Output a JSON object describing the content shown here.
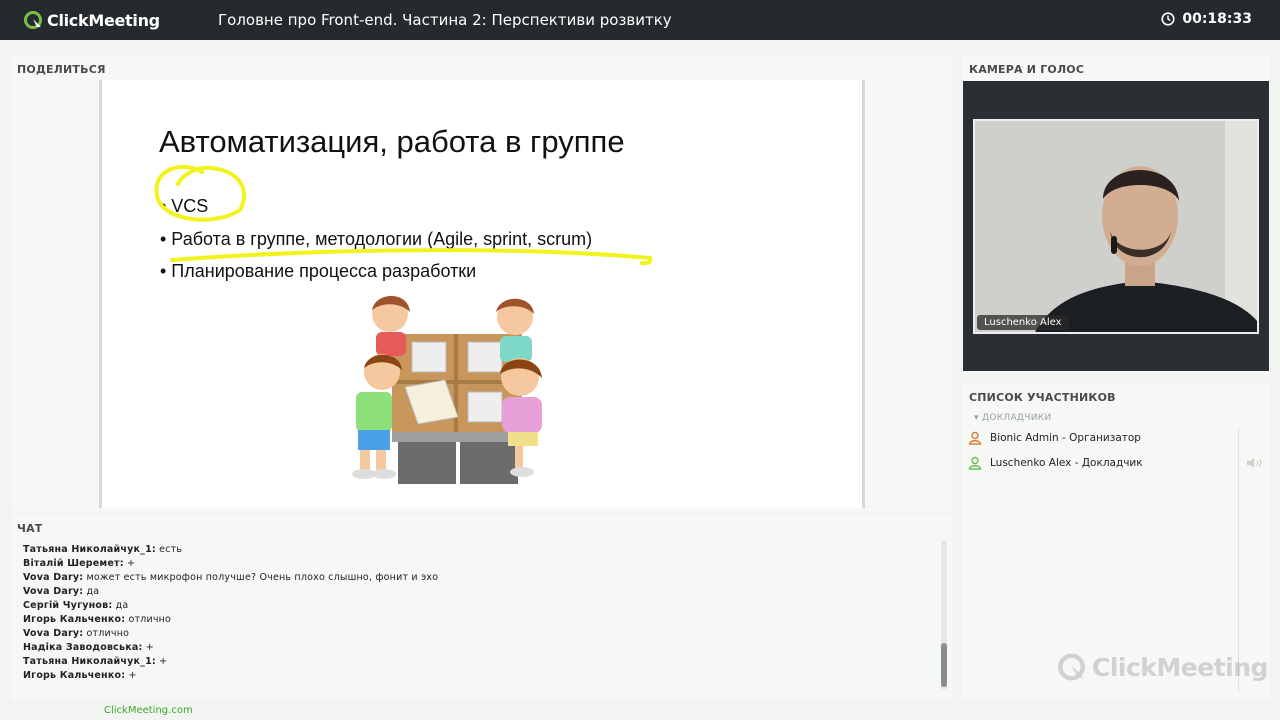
{
  "header": {
    "brand": "ClickMeeting",
    "title": "Головне про Front-end. Частина 2: Перспективи розвитку",
    "timer": "00:18:33"
  },
  "share": {
    "label": "ПОДЕЛИТЬСЯ",
    "slide": {
      "title": "Автоматизация, работа в группе",
      "bullets": [
        "• VCS",
        "• Работа в группе, методологии (Agile, sprint, scrum)",
        "• Планирование процесса разработки"
      ]
    }
  },
  "chat": {
    "label": "ЧАТ",
    "messages": [
      {
        "author": "Татьяна  Николайчук_1:",
        "text": "есть"
      },
      {
        "author": "Віталій Шеремет:",
        "text": "+"
      },
      {
        "author": "Vova Dary:",
        "text": "может есть микрофон получше? Очень плохо слышно, фонит и эхо"
      },
      {
        "author": "Vova Dary:",
        "text": "да"
      },
      {
        "author": "Сергій Чугунов:",
        "text": "да"
      },
      {
        "author": "Игорь Кальченко:",
        "text": "отлично"
      },
      {
        "author": "Vova Dary:",
        "text": "отлично"
      },
      {
        "author": "Надіка Заводовська:",
        "text": "+"
      },
      {
        "author": "Татьяна  Николайчук_1:",
        "text": "+"
      },
      {
        "author": "Игорь Кальченко:",
        "text": "+"
      }
    ]
  },
  "camera": {
    "label": "КАМЕРА И ГОЛОС",
    "name_tag": "Luschenko Alex"
  },
  "participants": {
    "label": "СПИСОК УЧАСТНИКОВ",
    "group": "ДОКЛАДЧИКИ",
    "items": [
      {
        "name": "Bionic Admin",
        "role": " - Организатор",
        "icon": "user-icon",
        "color": "#e07b3c"
      },
      {
        "name": "Luschenko Alex",
        "role": " - Докладчик",
        "icon": "user-icon",
        "color": "#6cbf4a"
      }
    ]
  },
  "footer": {
    "link": "ClickMeeting.com"
  },
  "watermark": "ClickMeeting",
  "colors": {
    "accent": "#3fa42e",
    "topbar": "#252a2d",
    "highlighter": "#f2f21c"
  }
}
